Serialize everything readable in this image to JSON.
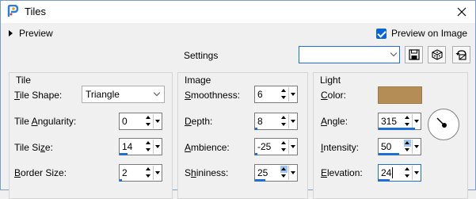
{
  "window": {
    "title": "Tiles"
  },
  "toprow": {
    "preview_label": "Preview",
    "preview_on_image_label": "Preview on Image",
    "preview_on_image_checked": true
  },
  "settings": {
    "label": "Settings",
    "preset_value": ""
  },
  "tile": {
    "title": "Tile",
    "shape_label": "Tile Shape:",
    "shape_value": "Triangle",
    "angularity_label": "Tile Angularity:",
    "angularity_value": "0",
    "size_label": "Tile Size:",
    "size_value": "14",
    "border_label": "Border Size:",
    "border_value": "2"
  },
  "image": {
    "title": "Image",
    "smoothness_label": "Smoothness:",
    "smoothness_value": "6",
    "depth_label": "Depth:",
    "depth_value": "8",
    "ambience_label": "Ambience:",
    "ambience_value": "-25",
    "shininess_label": "Shininess:",
    "shininess_value": "25"
  },
  "light": {
    "title": "Light",
    "color_label": "Color:",
    "color_value": "#b48c55",
    "angle_label": "Angle:",
    "angle_value": "315",
    "intensity_label": "Intensity:",
    "intensity_value": "50",
    "elevation_label": "Elevation:",
    "elevation_value": "24"
  },
  "colors": {
    "accent": "#1d6fd6",
    "checkbox": "#0a64d6"
  }
}
